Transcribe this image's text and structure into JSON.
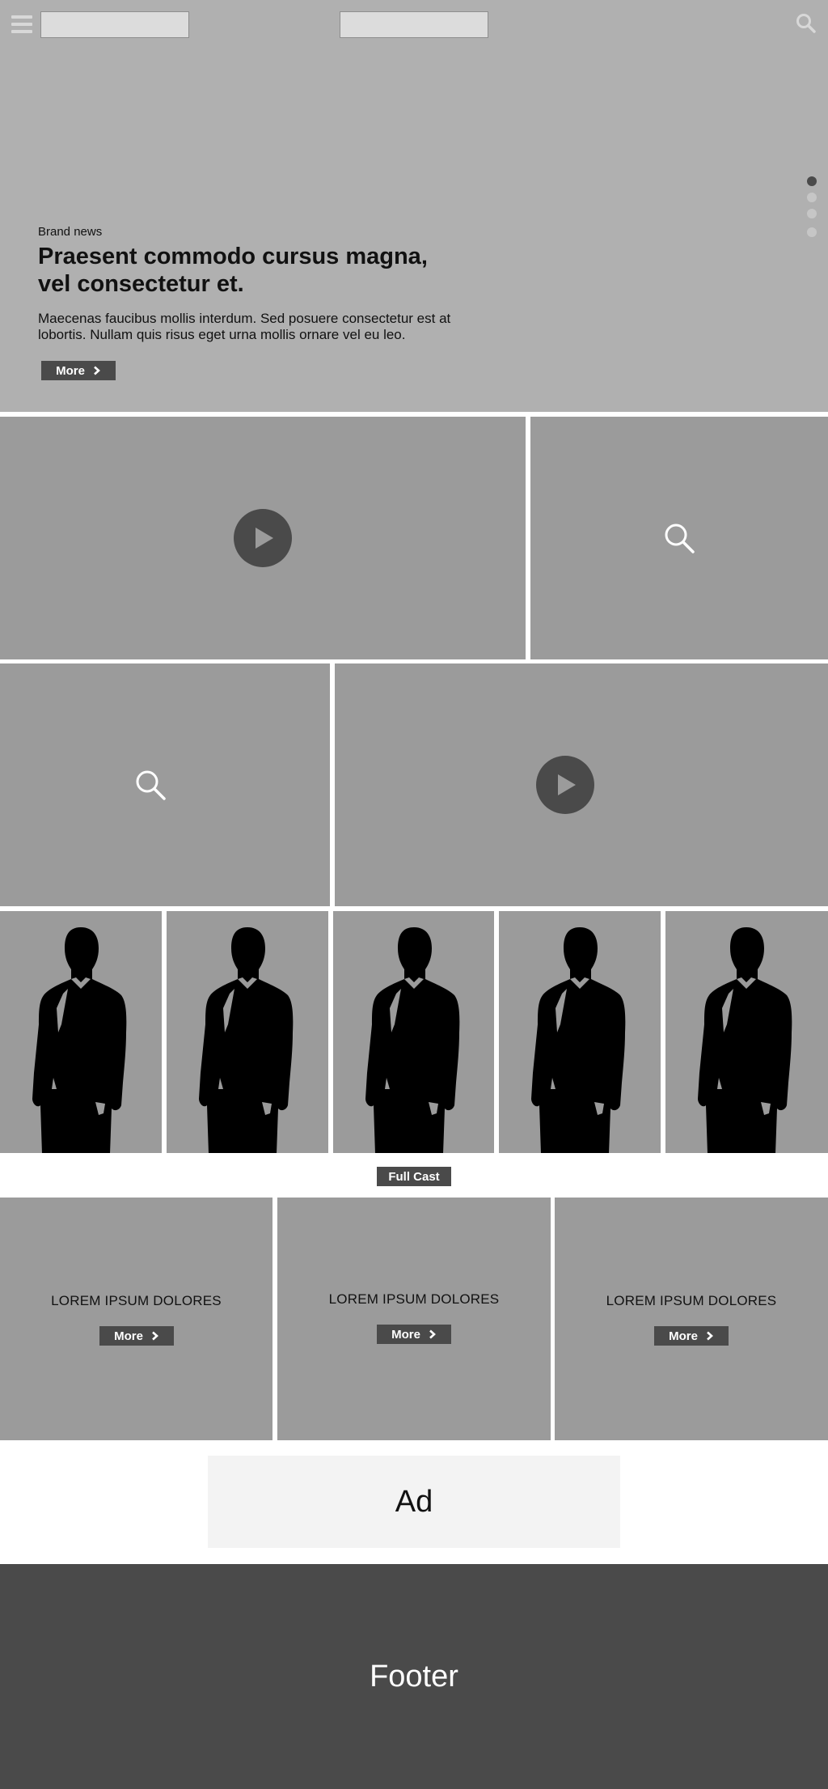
{
  "header": {
    "menu_icon": "hamburger-icon",
    "search_icon": "search-icon"
  },
  "hero": {
    "kicker": "Brand news",
    "headline_line1": "Praesent commodo cursus magna,",
    "headline_line2": "vel consectetur et.",
    "body_line1": "Maecenas faucibus mollis interdum. Sed posuere consectetur est at",
    "body_line2": "lobortis. Nullam quis risus eget urna mollis ornare vel eu leo.",
    "more_label": "More",
    "carousel_active_index": 0,
    "carousel_count": 4
  },
  "media_tiles": [
    {
      "kind": "video",
      "icon": "play-icon"
    },
    {
      "kind": "gallery",
      "icon": "search-icon"
    },
    {
      "kind": "gallery",
      "icon": "search-icon"
    },
    {
      "kind": "video",
      "icon": "play-icon"
    }
  ],
  "cast": {
    "member_count": 5,
    "image": "person-silhouette",
    "full_cast_label": "Full Cast"
  },
  "promos": [
    {
      "title": "LOREM IPSUM DOLORES",
      "more_label": "More"
    },
    {
      "title": "LOREM IPSUM DOLORES",
      "more_label": "More"
    },
    {
      "title": "LOREM IPSUM DOLORES",
      "more_label": "More"
    }
  ],
  "ad": {
    "label": "Ad"
  },
  "footer": {
    "label": "Footer"
  },
  "colors": {
    "hero_bg": "#b0b0b0",
    "tile_bg": "#9b9b9b",
    "button_bg": "#4a4a4a",
    "footer_bg": "#4a4a4a",
    "ad_bg": "#f3f3f3"
  }
}
